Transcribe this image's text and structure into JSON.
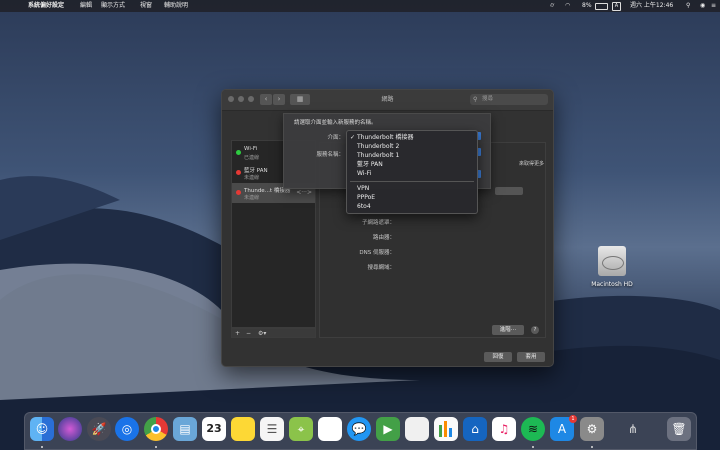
{
  "menubar": {
    "app_menu": "系統偏好設定",
    "items": [
      "編輯",
      "顯示方式",
      "視窗",
      "輔助說明"
    ],
    "battery": "8%",
    "input_source": "A",
    "clock": "週六 上午12:46"
  },
  "window": {
    "title": "網路",
    "search_placeholder": "搜尋",
    "services": [
      {
        "name": "Wi-Fi",
        "status": "已連線",
        "color": "#2ecc40"
      },
      {
        "name": "藍牙 PAN",
        "status": "未連線",
        "color": "#e53935"
      },
      {
        "name": "Thunde...t 橋接器",
        "status": "未連線",
        "color": "#e53935"
      }
    ],
    "sidebar_footer": {
      "add": "+",
      "remove": "−",
      "gear": "⚙▾"
    },
    "panel": {
      "partial_text": "來取得更多",
      "labels": [
        "子網路遮罩：",
        "路由器：",
        "DNS 伺服器：",
        "搜尋網域："
      ],
      "advanced_button": "進階⋯",
      "help": "?"
    },
    "revert_button": "回復",
    "apply_button": "套用"
  },
  "sheet": {
    "prompt": "請選取介面並輸入新服務的名稱。",
    "interface_label": "介面：",
    "service_name_label": "服務名稱："
  },
  "interface_menu": {
    "selected": "Thunderbolt 橋接器",
    "options": [
      "Thunderbolt 橋接器",
      "Thunderbolt 2",
      "Thunderbolt 1",
      "藍牙 PAN",
      "Wi-Fi"
    ],
    "options2": [
      "VPN",
      "PPPoE",
      "6to4"
    ]
  },
  "desktop": {
    "disk_label": "Macintosh HD"
  },
  "dock": {
    "apps": [
      "finder-icon",
      "siri-icon",
      "launchpad-icon",
      "safari-icon",
      "chrome-icon",
      "preview-icon",
      "calendar-icon",
      "notes-icon",
      "reminders-icon",
      "maps-icon",
      "photos-icon",
      "messages-icon",
      "facetime-icon",
      "keynote-icon",
      "numbers-icon",
      "keynote2-icon",
      "music-icon",
      "spotify-icon",
      "appstore-icon",
      "system-preferences-icon",
      "downloads-icon",
      "trash-icon"
    ],
    "calendar_day": "23",
    "appstore_badge": "1"
  }
}
